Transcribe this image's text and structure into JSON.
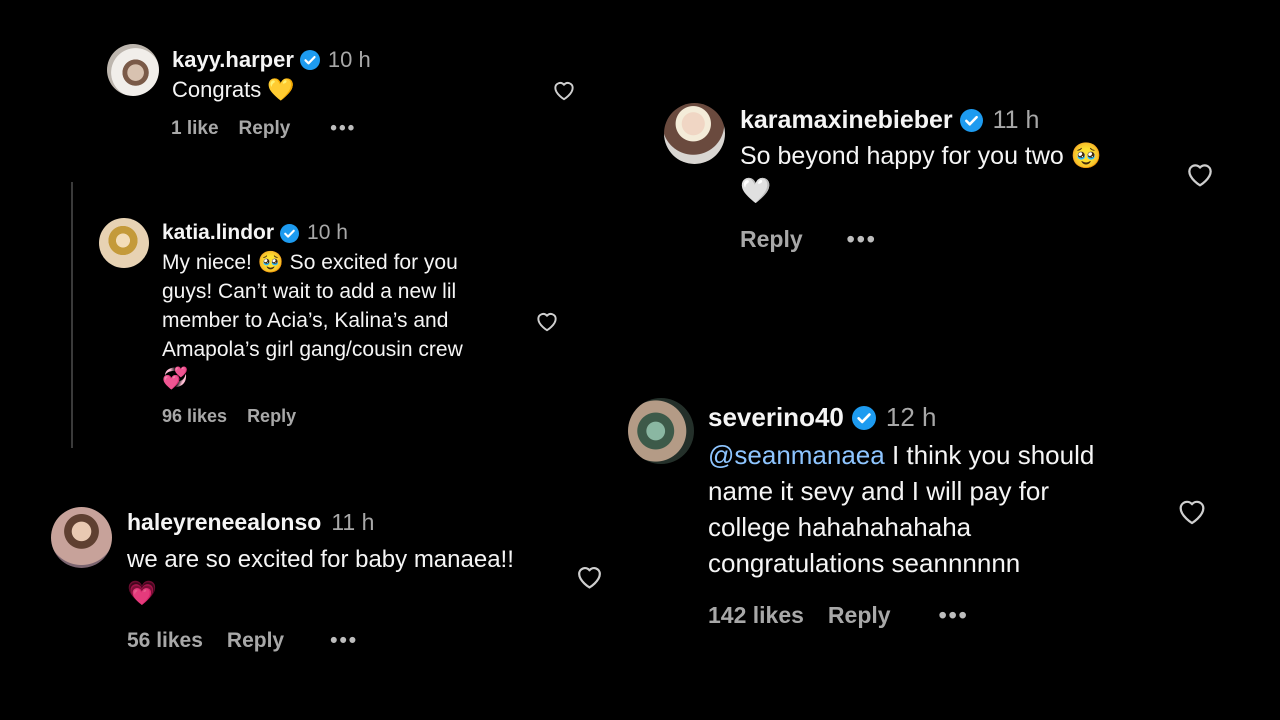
{
  "comments": {
    "kayy": {
      "username": "kayy.harper",
      "time": "10 h",
      "lines": [
        "Congrats 💛"
      ],
      "likes": "1 like",
      "reply": "Reply",
      "more": "•••"
    },
    "katia": {
      "username": "katia.lindor",
      "time": "10 h",
      "lines": [
        "My niece! 🥹 So excited for you",
        "guys! Can’t wait to add a new lil",
        "member to Acia’s, Kalina’s and",
        "Amapola’s girl gang/cousin crew",
        "💞"
      ],
      "likes": "96 likes",
      "reply": "Reply"
    },
    "haley": {
      "username": "haleyreneealonso",
      "time": "11 h",
      "lines": [
        "we are so excited for baby manaea!!",
        "💗"
      ],
      "likes": "56 likes",
      "reply": "Reply",
      "more": "•••"
    },
    "kara": {
      "username": "karamaxinebieber",
      "time": "11 h",
      "lines": [
        "So beyond happy for you two 🥹",
        "🤍"
      ],
      "reply": "Reply",
      "more": "•••"
    },
    "severino": {
      "username": "severino40",
      "time": "12 h",
      "mention": "@seanmanaea",
      "line1_rest": " I think you should",
      "lines": [
        "name it sevy and I will pay for",
        "college hahahahahaha",
        "congratulations seannnnnn"
      ],
      "likes": "142 likes",
      "reply": "Reply",
      "more": "•••"
    }
  },
  "icons": {
    "heart": "heart-outline-icon",
    "verified": "verified-badge-icon"
  },
  "colors": {
    "background": "#000000",
    "verified": "#1d9bf0",
    "mention": "#8ec5ff",
    "meta": "#a8a8a8"
  }
}
